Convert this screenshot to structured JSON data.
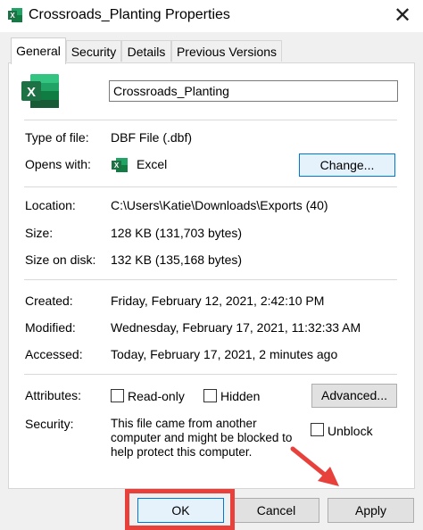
{
  "window": {
    "title": "Crossroads_Planting Properties",
    "close_glyph": "✕"
  },
  "tabs": [
    {
      "label": "General",
      "active": true
    },
    {
      "label": "Security",
      "active": false
    },
    {
      "label": "Details",
      "active": false
    },
    {
      "label": "Previous Versions",
      "active": false
    }
  ],
  "general": {
    "file_name": "Crossroads_Planting",
    "rows": {
      "type": {
        "label": "Type of file:",
        "value": "DBF File (.dbf)"
      },
      "opens": {
        "label": "Opens with:",
        "value": "Excel",
        "change_label": "Change..."
      },
      "location": {
        "label": "Location:",
        "value": "C:\\Users\\Katie\\Downloads\\Exports (40)"
      },
      "size": {
        "label": "Size:",
        "value": "128 KB (131,703 bytes)"
      },
      "size_on_disk": {
        "label": "Size on disk:",
        "value": "132 KB (135,168 bytes)"
      },
      "created": {
        "label": "Created:",
        "value": "Friday, February 12, 2021, 2:42:10 PM"
      },
      "modified": {
        "label": "Modified:",
        "value": "Wednesday, February 17, 2021, 11:32:33 AM"
      },
      "accessed": {
        "label": "Accessed:",
        "value": "Today, February 17, 2021, 2 minutes ago"
      }
    },
    "attributes": {
      "label": "Attributes:",
      "readonly_label": "Read-only",
      "readonly_checked": false,
      "hidden_label": "Hidden",
      "hidden_checked": false,
      "advanced_label": "Advanced..."
    },
    "security": {
      "label": "Security:",
      "line1": "This file came from another",
      "line2": "computer and might be blocked to",
      "line3": "help protect this computer.",
      "unblock_label": "Unblock",
      "unblock_checked": false
    }
  },
  "footer": {
    "ok_label": "OK",
    "cancel_label": "Cancel",
    "apply_label": "Apply"
  },
  "colors": {
    "annotation": "#e8413c",
    "excel_green": "#1e7145",
    "accent_blue": "#0078d7"
  },
  "icons": {
    "app": "excel-icon",
    "close": "close-icon"
  }
}
